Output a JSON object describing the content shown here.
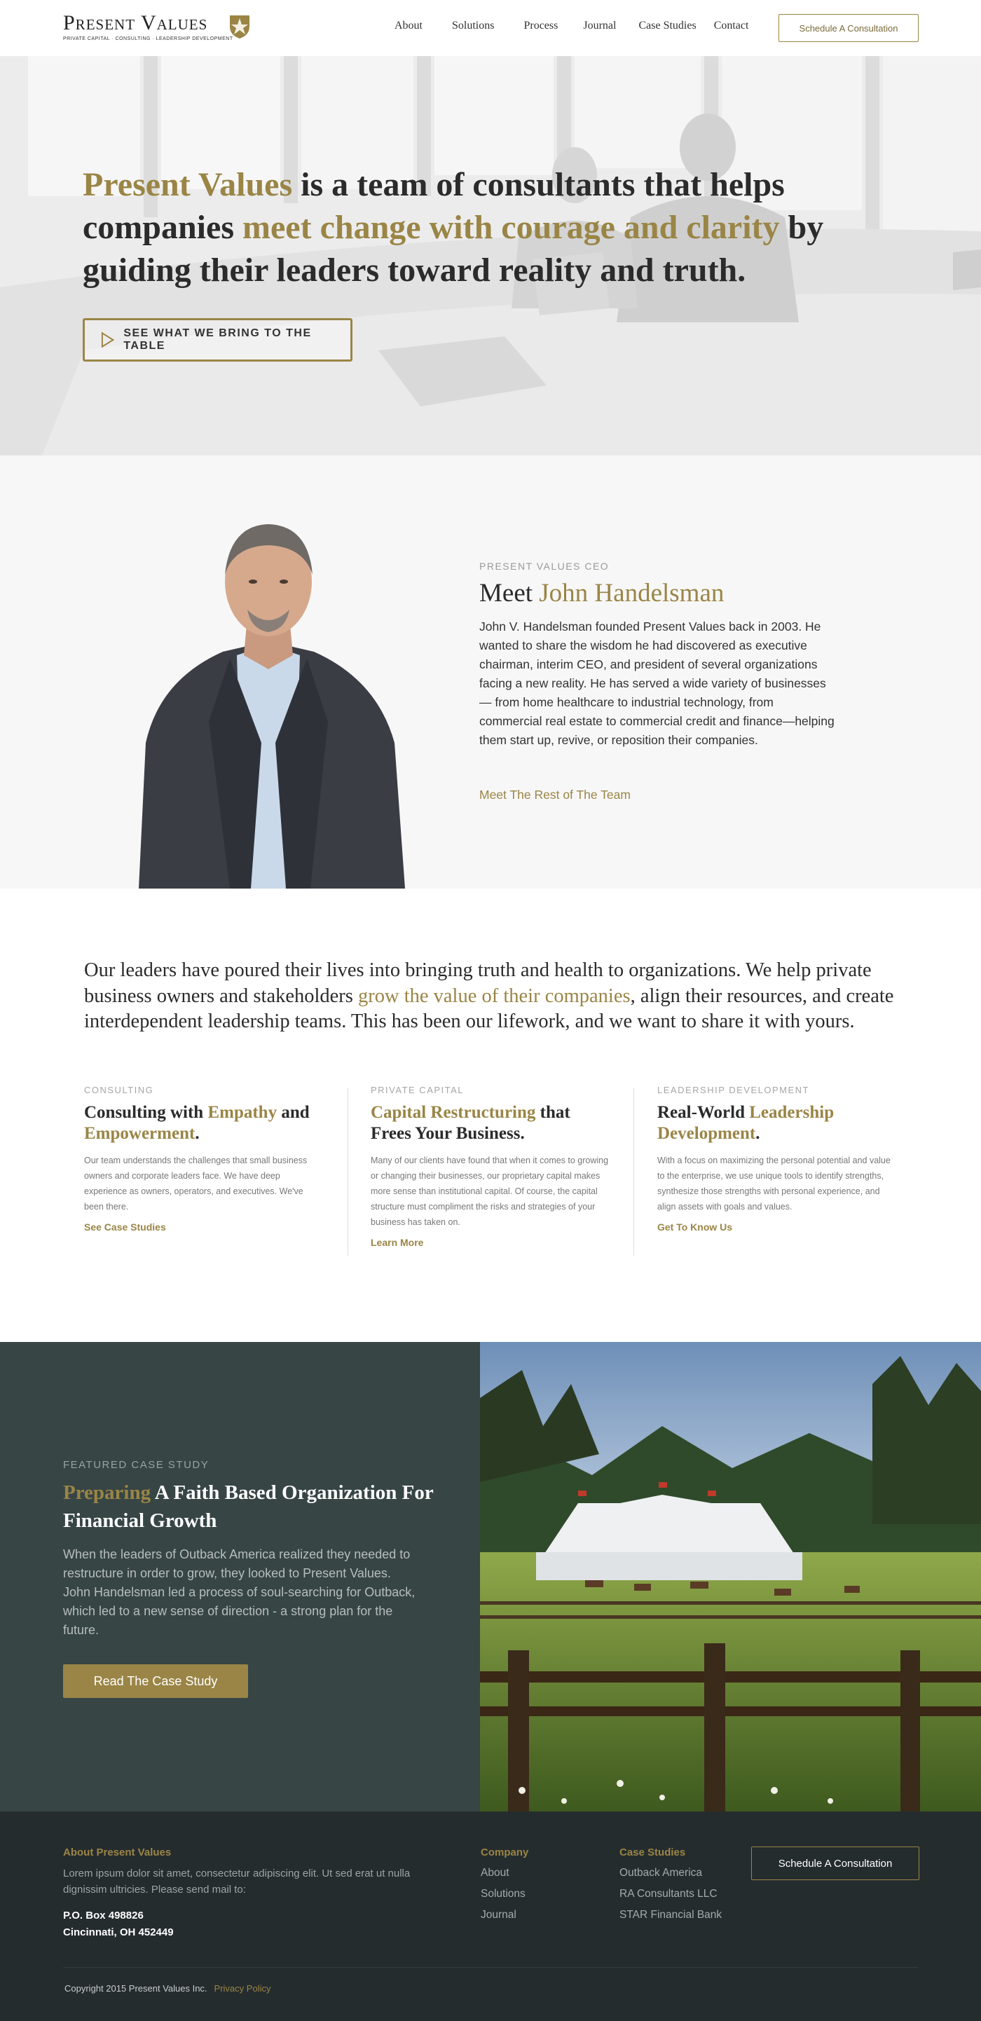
{
  "header": {
    "logo_name": "Present Values",
    "logo_tagline": "PRIVATE CAPITAL · CONSULTING · LEADERSHIP DEVELOPMENT",
    "nav": [
      "About",
      "Solutions",
      "Process",
      "Journal",
      "Case Studies",
      "Contact"
    ],
    "cta": "Schedule A Consultation"
  },
  "hero": {
    "headline_part1": "Present Values",
    "headline_part2": " is a team of consultants that helps companies ",
    "headline_part3": "meet change with courage and clarity",
    "headline_part4": " by guiding their leaders toward reality and truth.",
    "button": "SEE WHAT WE BRING TO THE TABLE"
  },
  "ceo": {
    "eyebrow": "PRESENT VALUES CEO",
    "title_prefix": "Meet ",
    "title_name": "John Handelsman",
    "bio": "John V. Handelsman founded Present Values back in 2003. He wanted to share the wisdom he had discovered as executive chairman, interim CEO, and president of several organizations facing a new reality. He has served a wide variety of businesses — from home healthcare to industrial technology, from commercial real estate to commercial credit and finance—helping them start up, revive, or reposition their companies.",
    "link": "Meet The Rest of The Team"
  },
  "mission": {
    "intro_part1": "Our leaders have poured their lives into bringing truth and health to organizations. We help private business owners and stakeholders ",
    "intro_highlight": "grow the value of their companies",
    "intro_part2": ", align their resources, and create interdependent leadership teams. This has been our lifework, and we want to share it with yours.",
    "columns": [
      {
        "eyebrow": "CONSULTING",
        "t1": "Consulting with ",
        "t2": "Empathy",
        "t3": " and ",
        "t4": "Empowerment",
        "t5": ".",
        "body": "Our team understands the challenges that small business owners and corporate leaders face. We have deep experience as owners, operators, and executives. We've been there.",
        "link": "See Case Studies"
      },
      {
        "eyebrow": "PRIVATE CAPITAL",
        "t1": "",
        "t2": "Capital Restructuring",
        "t3": " that Frees Your Business.",
        "t4": "",
        "t5": "",
        "body": "Many of our clients have found that when it comes to growing or changing their businesses, our proprietary capital makes more sense than institutional capital. Of course, the capital structure must compliment the risks and strategies of your business has taken on.",
        "link": "Learn More"
      },
      {
        "eyebrow": "LEADERSHIP DEVELOPMENT",
        "t1": "Real-World ",
        "t2": "Leadership Development",
        "t3": ".",
        "t4": "",
        "t5": "",
        "body": "With a focus on maximizing the personal potential and value to the enterprise, we use unique tools to identify strengths, synthesize those strengths with personal experience, and align assets with goals and values.",
        "link": "Get To Know Us"
      }
    ]
  },
  "case_study": {
    "eyebrow": "FEATURED CASE STUDY",
    "title_highlight": "Preparing",
    "title_rest": " A Faith Based Organization For Financial Growth",
    "body": "When the leaders of Outback America realized they needed to restructure in order to grow, they looked to Present Values. John Handelsman led a process of soul-searching for Outback, which led to a new sense of direction - a strong plan for the future.",
    "button": "Read The Case Study"
  },
  "footer": {
    "about_heading": "About Present Values",
    "about_text": "Lorem ipsum dolor sit amet, consectetur adipiscing elit. Ut sed erat ut nulla dignissim ultricies. Please send mail to:",
    "address_line1": "P.O. Box 498826",
    "address_line2": "Cincinnati, OH 452449",
    "company_heading": "Company",
    "company_links": [
      "About",
      "Solutions",
      "Journal"
    ],
    "cases_heading": "Case Studies",
    "cases_links": [
      "Outback America",
      "RA Consultants LLC",
      "STAR Financial Bank"
    ],
    "cta": "Schedule A Consultation",
    "copyright": "Copyright 2015 Present Values Inc.",
    "privacy": "Privacy Policy"
  },
  "colors": {
    "gold": "#9a8546",
    "dark_teal": "#374545",
    "footer": "#252c2e"
  }
}
